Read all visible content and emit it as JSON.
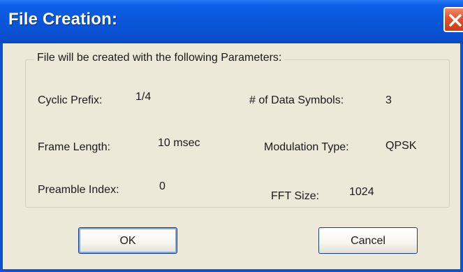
{
  "window": {
    "title": "File Creation:"
  },
  "group": {
    "legend": "File will be created with the following Parameters:"
  },
  "params": {
    "cyclic_prefix": {
      "label": "Cyclic Prefix:",
      "value": "1/4"
    },
    "data_symbols": {
      "label": "# of Data Symbols:",
      "value": "3"
    },
    "frame_length": {
      "label": "Frame Length:",
      "value": "10 msec"
    },
    "modulation_type": {
      "label": "Modulation Type:",
      "value": "QPSK"
    },
    "preamble_index": {
      "label": "Preamble Index:",
      "value": "0"
    },
    "fft_size": {
      "label": "FFT Size:",
      "value": "1024"
    }
  },
  "buttons": {
    "ok": "OK",
    "cancel": "Cancel"
  },
  "icons": {
    "close": "close-icon"
  },
  "colors": {
    "titlebar": "#0a55d8",
    "close_button": "#e0532c",
    "dialog_background": "#ece9d8"
  }
}
